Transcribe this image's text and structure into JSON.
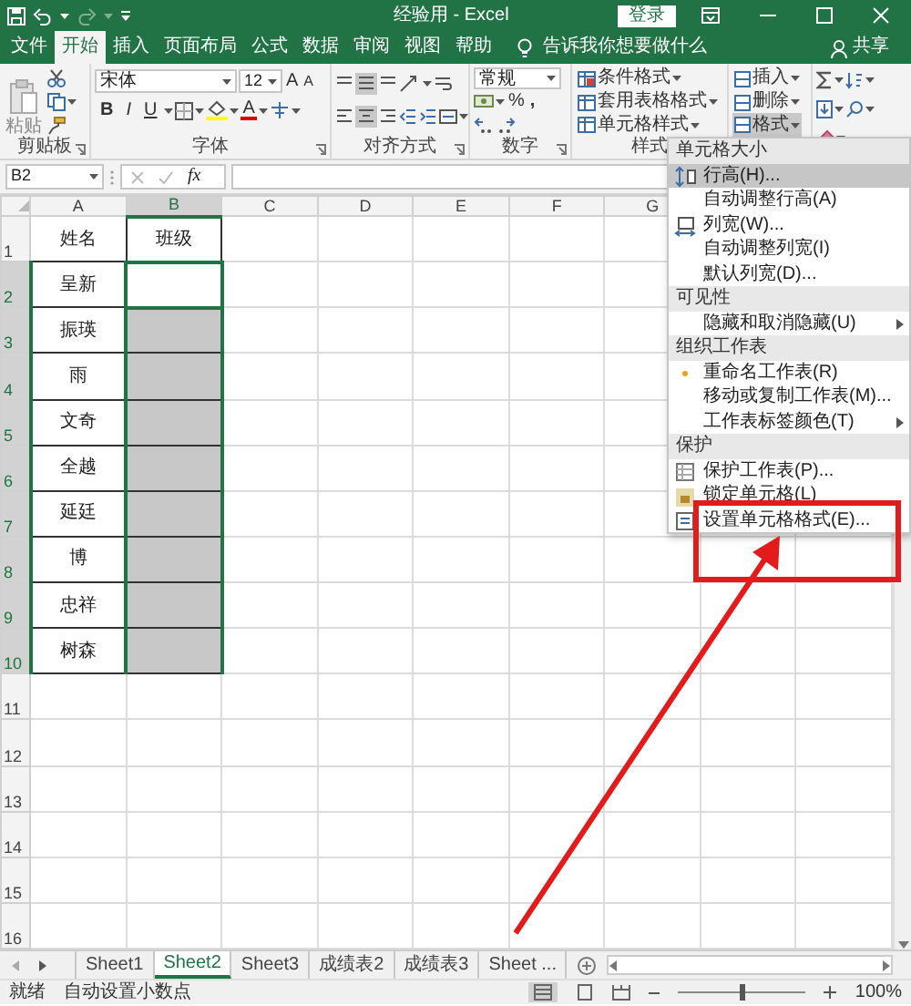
{
  "title_bar": {
    "title": "经验用 - Excel",
    "sign_in": "登录"
  },
  "tabs": [
    {
      "label": "文件",
      "selected": false
    },
    {
      "label": "开始",
      "selected": true
    },
    {
      "label": "插入",
      "selected": false
    },
    {
      "label": "页面布局",
      "selected": false
    },
    {
      "label": "公式",
      "selected": false
    },
    {
      "label": "数据",
      "selected": false
    },
    {
      "label": "审阅",
      "selected": false
    },
    {
      "label": "视图",
      "selected": false
    },
    {
      "label": "帮助",
      "selected": false
    }
  ],
  "tell_me": "告诉我你想要做什么",
  "share": "共享",
  "ribbon": {
    "clipboard": {
      "paste": "粘贴",
      "label": "剪贴板"
    },
    "font": {
      "name": "宋体",
      "size": "12",
      "grow": "A",
      "shrink": "A",
      "bold": "B",
      "italic": "I",
      "underline": "U",
      "color_letter": "A",
      "label": "字体"
    },
    "alignment": {
      "label": "对齐方式"
    },
    "number": {
      "format": "常规",
      "percent": "%",
      "comma": ",",
      "label": "数字"
    },
    "styles": {
      "items": [
        "条件格式",
        "套用表格格式",
        "单元格样式"
      ],
      "label": "样式"
    },
    "cells": {
      "items": [
        {
          "label": "插入",
          "selected": false
        },
        {
          "label": "删除",
          "selected": false
        },
        {
          "label": "格式",
          "selected": true
        }
      ]
    }
  },
  "formula_bar": {
    "name_box": "B2",
    "fx": "fx"
  },
  "sheet": {
    "columns": [
      {
        "label": "A",
        "selected": false
      },
      {
        "label": "B",
        "selected": true
      },
      {
        "label": "C",
        "selected": false
      },
      {
        "label": "D",
        "selected": false
      },
      {
        "label": "E",
        "selected": false
      },
      {
        "label": "F",
        "selected": false
      },
      {
        "label": "G",
        "selected": false
      }
    ],
    "rows": [
      {
        "header": "1",
        "name": "姓名",
        "class": "班级",
        "selected": false,
        "active": false
      },
      {
        "header": "2",
        "name": "呈新",
        "selected": true,
        "active": true
      },
      {
        "header": "3",
        "name": "振瑛",
        "selected": true,
        "active": false
      },
      {
        "header": "4",
        "name": "雨",
        "selected": true,
        "active": false
      },
      {
        "header": "5",
        "name": "文奇",
        "selected": true,
        "active": false
      },
      {
        "header": "6",
        "name": "全越",
        "selected": true,
        "active": false
      },
      {
        "header": "7",
        "name": "延廷",
        "selected": true,
        "active": false
      },
      {
        "header": "8",
        "name": "博",
        "selected": true,
        "active": false
      },
      {
        "header": "9",
        "name": "忠祥",
        "selected": true,
        "active": false
      },
      {
        "header": "10",
        "name": "树森",
        "selected": true,
        "active": false
      },
      {
        "header": "11",
        "selected": false,
        "active": false
      },
      {
        "header": "12",
        "selected": false,
        "active": false
      },
      {
        "header": "13",
        "selected": false,
        "active": false
      },
      {
        "header": "14",
        "selected": false,
        "active": false
      },
      {
        "header": "15",
        "selected": false,
        "active": false
      },
      {
        "header": "16",
        "selected": false,
        "active": false
      }
    ]
  },
  "sheet_tabs": [
    {
      "label": "Sheet1",
      "selected": false
    },
    {
      "label": "Sheet2",
      "selected": true
    },
    {
      "label": "Sheet3",
      "selected": false
    },
    {
      "label": "成绩表2",
      "selected": false
    },
    {
      "label": "成绩表3",
      "selected": false
    },
    {
      "label": "Sheet ...",
      "selected": false
    }
  ],
  "status_bar": {
    "ready": "就绪",
    "message": "自动设置小数点",
    "zoom": "100%",
    "zoom_slider": {
      "level": 0.5
    }
  },
  "format_menu": [
    {
      "kind": "header",
      "label": "单元格大小"
    },
    {
      "kind": "item",
      "label": "行高(H)...",
      "selected": true,
      "submenu": false
    },
    {
      "kind": "item",
      "label": "自动调整行高(A)",
      "selected": false,
      "submenu": false
    },
    {
      "kind": "item",
      "label": "列宽(W)...",
      "selected": false,
      "submenu": false
    },
    {
      "kind": "item",
      "label": "自动调整列宽(I)",
      "selected": false,
      "submenu": false
    },
    {
      "kind": "item",
      "label": "默认列宽(D)...",
      "selected": false,
      "submenu": false
    },
    {
      "kind": "header",
      "label": "可见性"
    },
    {
      "kind": "item",
      "label": "隐藏和取消隐藏(U)",
      "selected": false,
      "submenu": true
    },
    {
      "kind": "header",
      "label": "组织工作表"
    },
    {
      "kind": "item",
      "label": "重命名工作表(R)",
      "selected": false,
      "submenu": false
    },
    {
      "kind": "item",
      "label": "移动或复制工作表(M)...",
      "selected": false,
      "submenu": false
    },
    {
      "kind": "item",
      "label": "工作表标签颜色(T)",
      "selected": false,
      "submenu": true
    },
    {
      "kind": "header",
      "label": "保护"
    },
    {
      "kind": "item",
      "label": "保护工作表(P)...",
      "selected": false,
      "submenu": false
    },
    {
      "kind": "item",
      "label": "锁定单元格(L)",
      "selected": false,
      "submenu": false
    },
    {
      "kind": "item",
      "label": "设置单元格格式(E)...",
      "selected": false,
      "submenu": false
    }
  ],
  "annotation": {
    "frame": true,
    "arrow": true
  }
}
